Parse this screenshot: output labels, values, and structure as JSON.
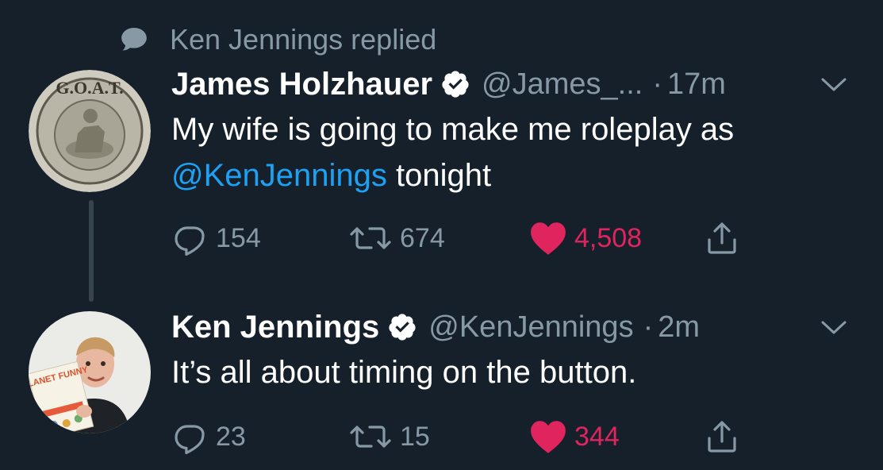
{
  "reply_header": {
    "text": "Ken Jennings replied",
    "icon": "speech-bubble-icon"
  },
  "colors": {
    "background": "#15202b",
    "secondary_text": "#8899a6",
    "link": "#1da1f2",
    "like": "#e0245e"
  },
  "tweets": [
    {
      "name": "James Holzhauer",
      "handle": "@James_...",
      "time": "17m",
      "body_text": "My wife is going to make me roleplay as",
      "mention": "@KenJennings",
      "body_tail": " tonight",
      "avatar_text": "G.O.A.T.",
      "actions": {
        "replies": "154",
        "retweets": "674",
        "likes": "4,508"
      }
    },
    {
      "name": "Ken Jennings",
      "handle": "@KenJennings",
      "time": "2m",
      "body_text": "It’s all about timing on the button.",
      "avatar_book_text": "PLANET FUNNY",
      "actions": {
        "replies": "23",
        "retweets": "15",
        "likes": "344"
      }
    }
  ]
}
